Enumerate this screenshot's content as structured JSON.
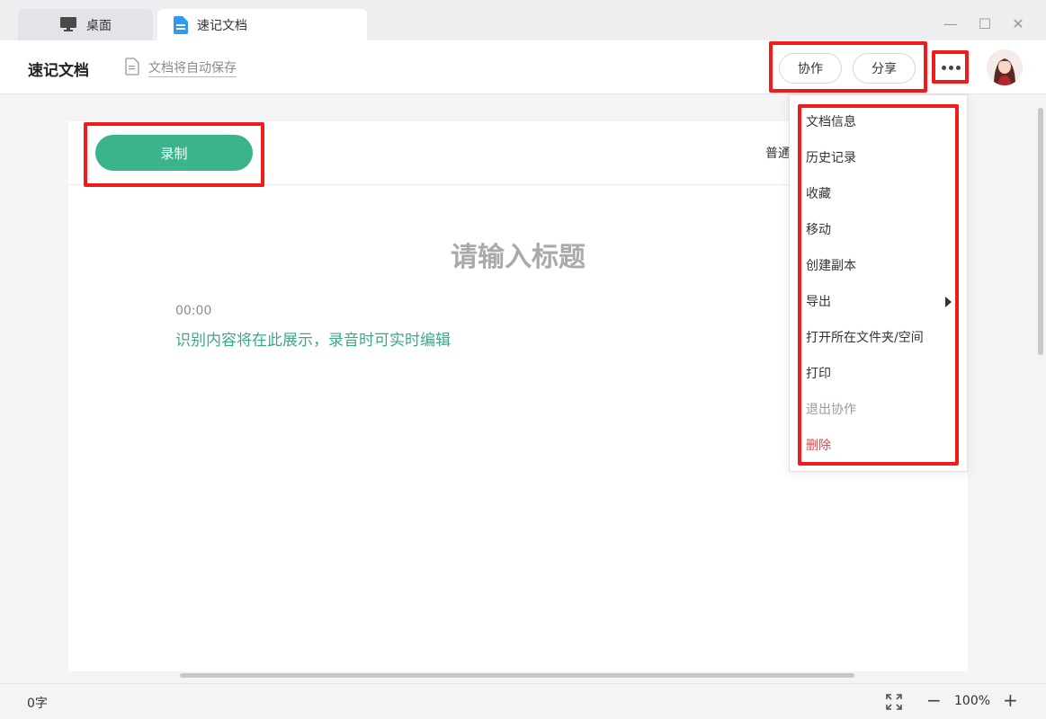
{
  "tabs": [
    {
      "label": "桌面",
      "icon": "monitor-icon"
    },
    {
      "label": "速记文档",
      "icon": "doc-icon"
    }
  ],
  "window": {
    "minimize": "—",
    "maximize": "☐",
    "close": "✕"
  },
  "header": {
    "title": "速记文档",
    "autosave": "文档将自动保存",
    "collab_label": "协作",
    "share_label": "分享",
    "more_icon": "more-dots-icon",
    "avatar_icon": "user-avatar"
  },
  "editor": {
    "record_label": "录制",
    "mode_label": "普通",
    "title_placeholder": "请输入标题",
    "timestamp": "00:00",
    "hint": "识别内容将在此展示，录音时可实时编辑"
  },
  "menu": {
    "items": [
      {
        "label": "文档信息"
      },
      {
        "label": "历史记录"
      },
      {
        "label": "收藏"
      },
      {
        "label": "移动"
      },
      {
        "label": "创建副本"
      },
      {
        "label": "导出",
        "has_submenu": true
      },
      {
        "label": "打开所在文件夹/空间"
      },
      {
        "label": "打印"
      },
      {
        "label": "退出协作",
        "state": "disabled"
      },
      {
        "label": "删除",
        "state": "danger"
      }
    ]
  },
  "footer": {
    "word_count": "0字",
    "zoom": "100%",
    "zoom_out": "−",
    "zoom_in": "+"
  },
  "colors": {
    "accent_green": "#3bb48c",
    "highlight_red": "#f21b1b",
    "danger_red": "#e0484d"
  }
}
